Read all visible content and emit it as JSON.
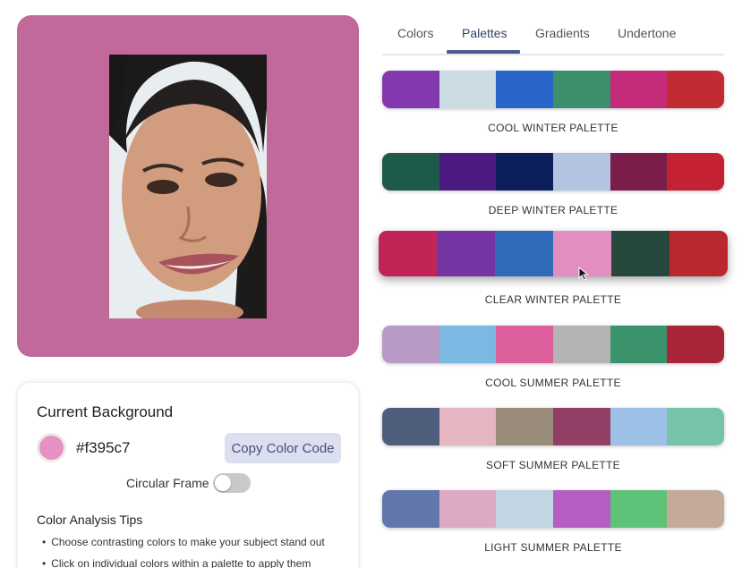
{
  "preview": {
    "background": "#c2699c"
  },
  "current_background": {
    "title": "Current Background",
    "hex": "#f395c7",
    "swatch_color": "#e690c4",
    "copy_button": "Copy Color Code",
    "circular_frame_label": "Circular Frame",
    "circular_frame_on": false
  },
  "tips": {
    "title": "Color Analysis Tips",
    "items": [
      "Choose contrasting colors to make your subject stand out",
      "Click on individual colors within a palette to apply them"
    ]
  },
  "tabs": [
    {
      "label": "Colors",
      "active": false
    },
    {
      "label": "Palettes",
      "active": true
    },
    {
      "label": "Gradients",
      "active": false
    },
    {
      "label": "Undertone",
      "active": false
    }
  ],
  "palettes": [
    {
      "name": "COOL WINTER PALETTE",
      "colors": [
        "#8338b0",
        "#cbdde2",
        "#2a66c9",
        "#3b906b",
        "#c42c7a",
        "#c22a34"
      ]
    },
    {
      "name": "DEEP WINTER PALETTE",
      "colors": [
        "#1e5a4a",
        "#4b1a80",
        "#0d1f5a",
        "#b3c4e0",
        "#7a1d4a",
        "#c42232"
      ]
    },
    {
      "name": "CLEAR WINTER PALETTE",
      "colors": [
        "#c22555",
        "#7434a2",
        "#2f6bb8",
        "#e38ec0",
        "#27493d",
        "#b8282c"
      ]
    },
    {
      "name": "COOL SUMMER PALETTE",
      "colors": [
        "#b89ac6",
        "#7bb9e2",
        "#dc5e9a",
        "#b2b3b3",
        "#3b936b",
        "#a82539"
      ]
    },
    {
      "name": "SOFT SUMMER PALETTE",
      "colors": [
        "#4f5e7d",
        "#e6b5c2",
        "#9a8c7a",
        "#923f68",
        "#9cc0e6",
        "#75c4aa"
      ]
    },
    {
      "name": "LIGHT SUMMER PALETTE",
      "colors": [
        "#6277ab",
        "#dcabc3",
        "#c3d5e2",
        "#b55dc3",
        "#5ec278",
        "#c4aa99"
      ]
    }
  ]
}
